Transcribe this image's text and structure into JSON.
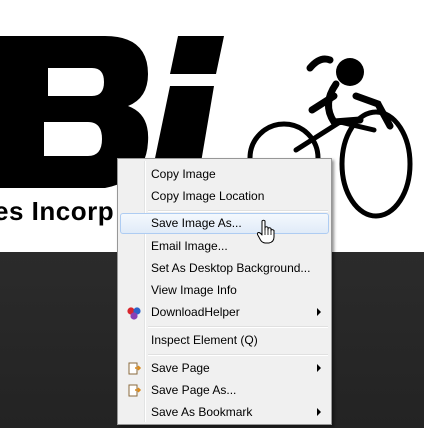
{
  "image": {
    "company_text": "es Incorp"
  },
  "menu": {
    "items": [
      {
        "label": "Copy Image",
        "icon": null,
        "submenu": false
      },
      {
        "label": "Copy Image Location",
        "icon": null,
        "submenu": false
      },
      {
        "label": "Save Image As...",
        "icon": null,
        "submenu": false,
        "highlighted": true
      },
      {
        "label": "Email Image...",
        "icon": null,
        "submenu": false
      },
      {
        "label": "Set As Desktop Background...",
        "icon": null,
        "submenu": false
      },
      {
        "label": "View Image Info",
        "icon": null,
        "submenu": false
      },
      {
        "label": "DownloadHelper",
        "icon": "downloadhelper-icon",
        "submenu": true
      },
      {
        "label": "Inspect Element (Q)",
        "icon": null,
        "submenu": false
      },
      {
        "label": "Save Page",
        "icon": "save-page-icon",
        "submenu": true
      },
      {
        "label": "Save Page As...",
        "icon": "save-page-icon",
        "submenu": false
      },
      {
        "label": "Save As Bookmark",
        "icon": null,
        "submenu": true
      }
    ]
  },
  "colors": {
    "highlight_border": "#aeccf2",
    "menu_background": "#f0f0f0",
    "page_dark": "#2a2a2a"
  }
}
